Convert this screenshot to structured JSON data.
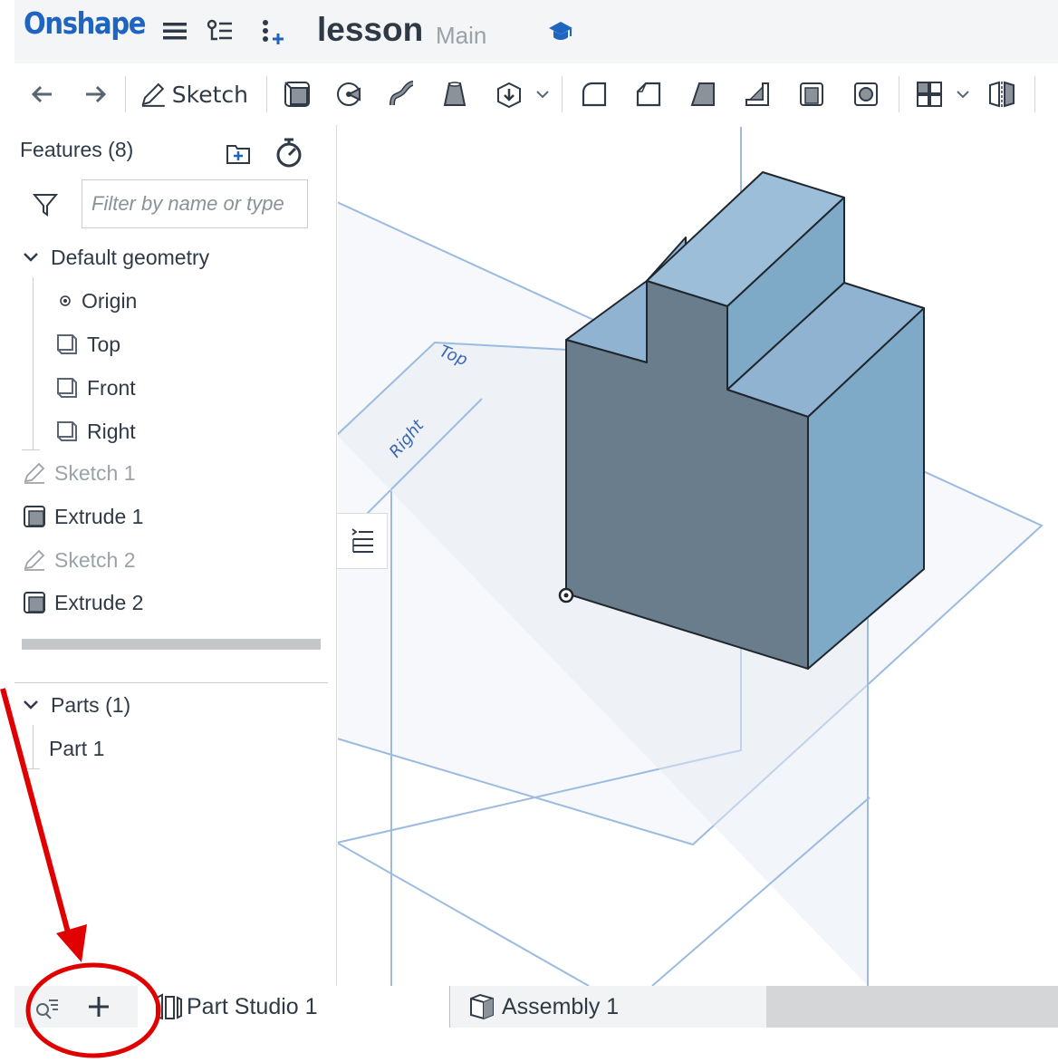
{
  "header": {
    "logo": "Onshape",
    "document_name": "lesson",
    "branch": "Main",
    "icons": [
      "hamburger-menu-icon",
      "feature-list-icon",
      "version-graph-icon",
      "learning-center-icon"
    ]
  },
  "toolbar": {
    "sketch_label": "Sketch",
    "icons": [
      "undo-icon",
      "redo-icon",
      "sketch-icon",
      "extrude-icon",
      "revolve-icon",
      "sweep-icon",
      "loft-icon",
      "thicken-icon",
      "fillet-icon",
      "chamfer-icon",
      "draft-icon",
      "rib-icon",
      "shell-icon",
      "hole-icon",
      "pattern-icon",
      "mirror-icon"
    ]
  },
  "feature_panel": {
    "title": "Features (8)",
    "filter_placeholder": "Filter by name or type",
    "default_geometry_label": "Default geometry",
    "default_geometry": [
      "Origin",
      "Top",
      "Front",
      "Right"
    ],
    "features": [
      {
        "label": "Sketch 1",
        "type": "sketch",
        "dim": true
      },
      {
        "label": "Extrude 1",
        "type": "extrude",
        "dim": false
      },
      {
        "label": "Sketch 2",
        "type": "sketch",
        "dim": true
      },
      {
        "label": "Extrude 2",
        "type": "extrude",
        "dim": false
      }
    ],
    "parts_label": "Parts (1)",
    "parts": [
      "Part 1"
    ]
  },
  "viewport": {
    "plane_labels": [
      "Top",
      "Right"
    ]
  },
  "tabs": [
    {
      "label": "Part Studio 1",
      "icon": "part-studio-icon",
      "active": true
    },
    {
      "label": "Assembly 1",
      "icon": "assembly-icon",
      "active": false
    }
  ],
  "colors": {
    "brand_blue": "#1f64c0",
    "plane_blue": "#7aa6d6",
    "part_front": "#6a7d8c",
    "part_top": "#8fb3d0",
    "part_side": "#7ea9c7",
    "annotation_red": "#e00000"
  }
}
